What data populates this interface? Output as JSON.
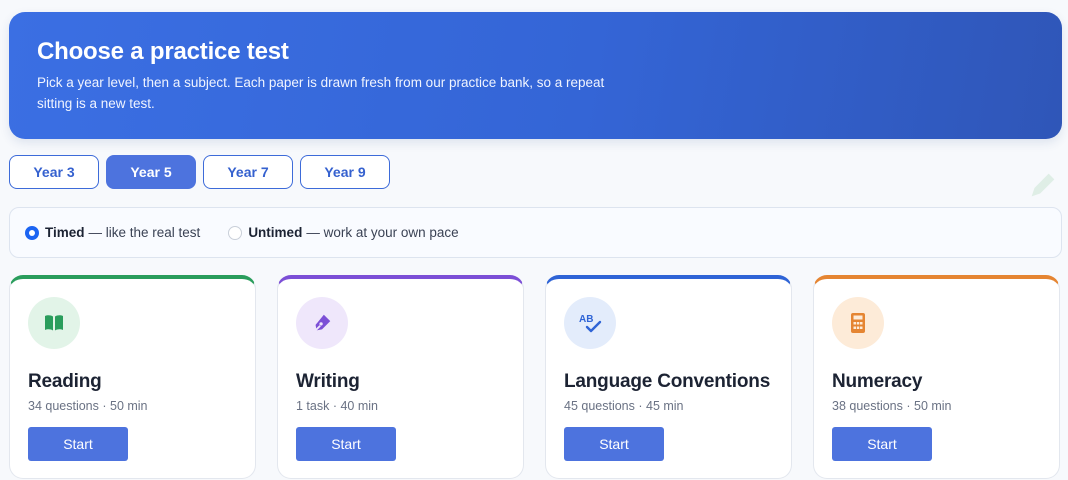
{
  "header": {
    "title": "Choose a practice test",
    "subtitle": "Pick a year level, then a subject. Each paper is drawn fresh from our practice bank, so a repeat sitting is a new test."
  },
  "years": [
    {
      "label": "Year 3",
      "active": false
    },
    {
      "label": "Year 5",
      "active": true
    },
    {
      "label": "Year 7",
      "active": false
    },
    {
      "label": "Year 9",
      "active": false
    }
  ],
  "mode": {
    "timed": {
      "label": "Timed",
      "desc": "— like the real test",
      "selected": true
    },
    "untimed": {
      "label": "Untimed",
      "desc": "— work at your own pace",
      "selected": false
    }
  },
  "subjects": [
    {
      "name": "Reading",
      "meta": "34 questions · 50 min",
      "button": "Start",
      "icon": "book-icon",
      "accent": "#2a9d5c"
    },
    {
      "name": "Writing",
      "meta": "1 task · 40 min",
      "button": "Start",
      "icon": "pen-icon",
      "accent": "#7c4fd6"
    },
    {
      "name": "Language Conventions",
      "meta": "45 questions · 45 min",
      "button": "Start",
      "icon": "spellcheck-icon",
      "accent": "#2f64d6"
    },
    {
      "name": "Numeracy",
      "meta": "38 questions · 50 min",
      "button": "Start",
      "icon": "calculator-icon",
      "accent": "#e58532"
    }
  ],
  "colors": {
    "primary": "#4d73de",
    "hero": "#3465d6"
  }
}
